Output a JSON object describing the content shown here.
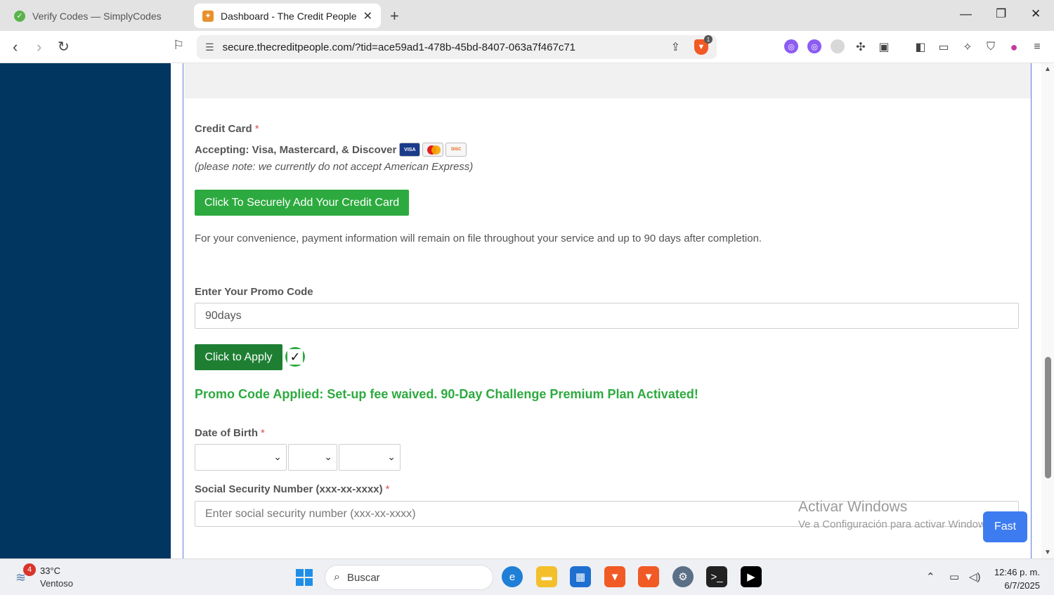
{
  "browser": {
    "tabs": [
      {
        "title": "Verify Codes — SimplyCodes",
        "active": false
      },
      {
        "title": "Dashboard - The Credit People",
        "active": true
      }
    ],
    "url": "secure.thecreditpeople.com/?tid=ace59ad1-478b-45bd-8407-063a7f467c71",
    "brave_badge": "1"
  },
  "form": {
    "credit_card_label": "Credit Card",
    "required_mark": "*",
    "accepting_text": "Accepting: Visa, Mastercard, & Discover",
    "cards": [
      "visa-icon",
      "mastercard-icon",
      "discover-icon"
    ],
    "amex_note": "(please note: we currently do not accept American Express)",
    "add_card_button": "Click To Securely Add Your Credit Card",
    "convenience_text": "For your convenience, payment information will remain on file throughout your service and up to 90 days after completion.",
    "promo_label": "Enter Your Promo Code",
    "promo_value": "90days",
    "apply_button": "Click to Apply",
    "promo_message": "Promo Code Applied: Set-up fee waived. 90-Day Challenge Premium Plan Activated!",
    "dob_label": "Date of Birth",
    "ssn_label": "Social Security Number (xxx-xx-xxxx)",
    "ssn_placeholder": "Enter social security number (xxx-xx-xxxx)"
  },
  "overlay": {
    "watermark_title": "Activar Windows",
    "watermark_sub": "Ve a Configuración para activar Windows.",
    "fast_button": "Fast"
  },
  "taskbar": {
    "weather_badge": "4",
    "temperature": "33°C",
    "condition": "Ventoso",
    "search_placeholder": "Buscar",
    "time": "12:46 p. m.",
    "date": "6/7/2025"
  },
  "colors": {
    "sidebar": "#003660",
    "green": "#2daa3f",
    "dark_green": "#1e7f33"
  }
}
